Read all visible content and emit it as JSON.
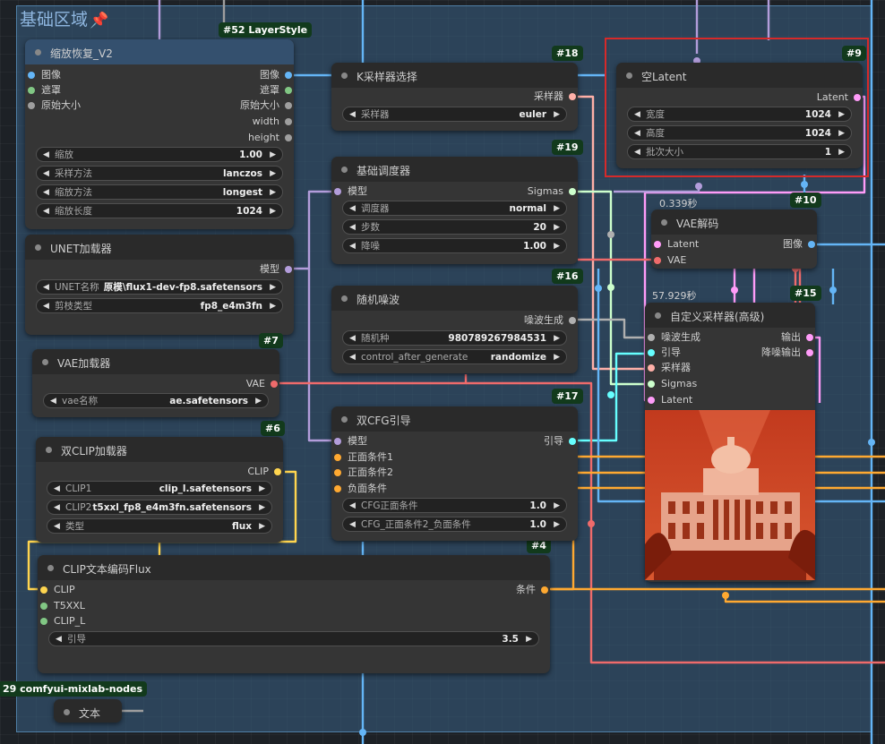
{
  "group": {
    "title": "基础区域",
    "pin": "📌"
  },
  "colors": {
    "image": "#64b5f6",
    "mask": "#81c784",
    "int": "#9e9e9e",
    "model": "#b39ddb",
    "clip": "#ffd54f",
    "vae": "#ef6b6b",
    "conditioning": "#ffa931",
    "latent": "#ff9cf9",
    "sigmas": "#cdffcd",
    "noise": "#b0b0b0",
    "sampler": "#ffb0a8",
    "guider": "#66ffff"
  },
  "badges": {
    "b52": "#52 LayerStyle",
    "b18": "#18",
    "b9": "#9",
    "b19": "#19",
    "b10": "#10",
    "b16": "#16",
    "b15": "#15",
    "b7": "#7",
    "b17": "#17",
    "b6": "#6",
    "b4": "#4",
    "b29": "29 comfyui-mixlab-nodes"
  },
  "timers": {
    "vae_decode": "0.339秒",
    "sampler_adv": "57.929秒"
  },
  "resize": {
    "title": "缩放恢复_V2",
    "inputs": [
      "图像",
      "遮罩",
      "原始大小"
    ],
    "outputs": [
      "图像",
      "遮罩",
      "原始大小",
      "width",
      "height"
    ],
    "widgets": [
      {
        "label": "缩放",
        "value": "1.00"
      },
      {
        "label": "采样方法",
        "value": "lanczos"
      },
      {
        "label": "缩放方法",
        "value": "longest"
      },
      {
        "label": "缩放长度",
        "value": "1024"
      }
    ]
  },
  "unet": {
    "title": "UNET加载器",
    "output": "模型",
    "widgets": [
      {
        "label": "UNET名称",
        "value": "原模\\flux1-dev-fp8.safetensors"
      },
      {
        "label": "剪枝类型",
        "value": "fp8_e4m3fn"
      }
    ]
  },
  "vae_loader": {
    "title": "VAE加载器",
    "output": "VAE",
    "widgets": [
      {
        "label": "vae名称",
        "value": "ae.safetensors"
      }
    ]
  },
  "dual_clip": {
    "title": "双CLIP加载器",
    "output": "CLIP",
    "widgets": [
      {
        "label": "CLIP1",
        "value": "clip_l.safetensors"
      },
      {
        "label": "CLIP2",
        "value": "t5xxl_fp8_e4m3fn.safetensors"
      },
      {
        "label": "类型",
        "value": "flux"
      }
    ]
  },
  "clip_text": {
    "title": "CLIP文本编码Flux",
    "inputs": [
      "CLIP",
      "T5XXL",
      "CLIP_L"
    ],
    "output": "条件",
    "widgets": [
      {
        "label": "引导",
        "value": "3.5"
      }
    ]
  },
  "text_node": {
    "title": "文本"
  },
  "ksampler_select": {
    "title": "K采样器选择",
    "output": "采样器",
    "widgets": [
      {
        "label": "采样器",
        "value": "euler"
      }
    ]
  },
  "scheduler": {
    "title": "基础调度器",
    "input": "模型",
    "output": "Sigmas",
    "widgets": [
      {
        "label": "调度器",
        "value": "normal"
      },
      {
        "label": "步数",
        "value": "20"
      },
      {
        "label": "降噪",
        "value": "1.00"
      }
    ]
  },
  "noise": {
    "title": "随机噪波",
    "output": "噪波生成",
    "widgets": [
      {
        "label": "随机种",
        "value": "980789267984531"
      },
      {
        "label": "control_after_generate",
        "value": "randomize"
      }
    ]
  },
  "cfg_guider": {
    "title": "双CFG引导",
    "inputs": [
      "模型",
      "正面条件1",
      "正面条件2",
      "负面条件"
    ],
    "output": "引导",
    "widgets": [
      {
        "label": "CFG正面条件",
        "value": "1.0"
      },
      {
        "label": "CFG_正面条件2_负面条件",
        "value": "1.0"
      }
    ]
  },
  "empty_latent": {
    "title": "空Latent",
    "output": "Latent",
    "widgets": [
      {
        "label": "宽度",
        "value": "1024"
      },
      {
        "label": "高度",
        "value": "1024"
      },
      {
        "label": "批次大小",
        "value": "1"
      }
    ]
  },
  "vae_decode": {
    "title": "VAE解码",
    "inputs": [
      "Latent",
      "VAE"
    ],
    "output": "图像"
  },
  "sampler_adv": {
    "title": "自定义采样器(高级)",
    "inputs": [
      "噪波生成",
      "引导",
      "采样器",
      "Sigmas",
      "Latent"
    ],
    "outputs": [
      "输出",
      "降噪输出"
    ]
  }
}
